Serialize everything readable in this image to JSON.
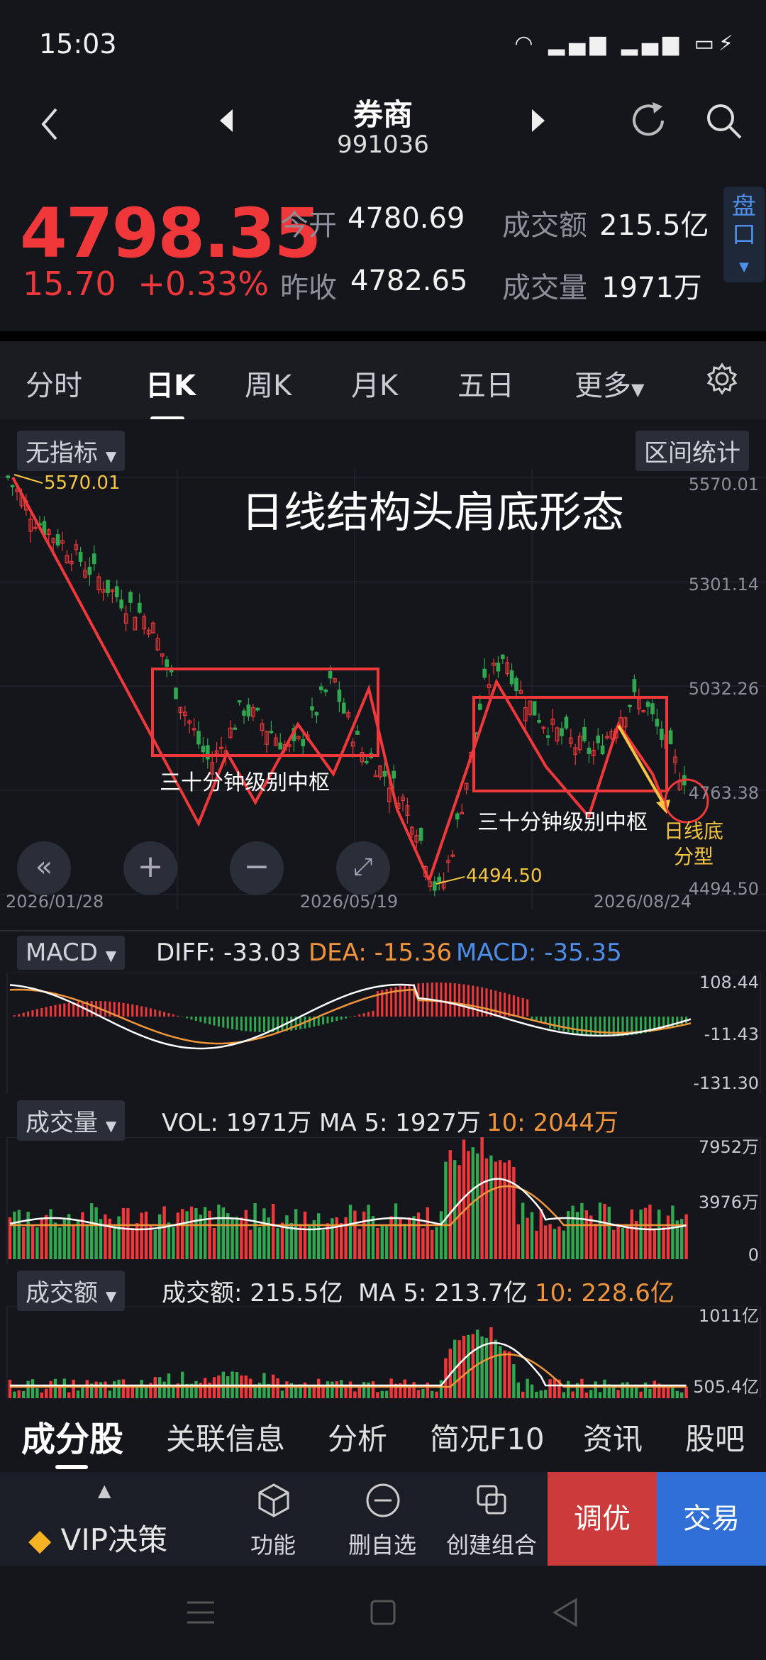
{
  "status": {
    "time": "15:03",
    "icons": "4G 4G"
  },
  "header": {
    "title": "券商",
    "code": "991036"
  },
  "quote": {
    "price": "4798.35",
    "change": "15.70",
    "change_pct": "+0.33%",
    "open_label": "今开",
    "open": "4780.69",
    "prev_label": "昨收",
    "prev": "4782.65",
    "amount_label": "成交额",
    "amount": "215.5亿",
    "volume_label": "成交量",
    "volume": "1971万",
    "pankou": "盘口"
  },
  "tabs": [
    "分时",
    "日K",
    "周K",
    "月K",
    "五日",
    "更多"
  ],
  "chart_toolbar": {
    "indicator": "无指标",
    "range_stats": "区间统计"
  },
  "chart_data": {
    "type": "candlestick",
    "y_ticks": [
      "5570.01",
      "5301.14",
      "5032.26",
      "4763.38",
      "4494.50"
    ],
    "x_ticks": [
      "2026/01/28",
      "2026/05/19",
      "2026/08/24"
    ],
    "high_label": "5570.01",
    "low_label": "4494.50",
    "annotation_title": "日线结构头肩底形态",
    "pivot_label": "三十分钟级别中枢",
    "bottom_label_1": "日线底",
    "bottom_label_2": "分型"
  },
  "macd": {
    "name": "MACD",
    "diff": "DIFF: -33.03",
    "dea": "DEA: -15.36",
    "macd": "MACD: -35.35",
    "ticks": [
      "108.44",
      "-11.43",
      "-131.30"
    ]
  },
  "vol": {
    "name": "成交量",
    "vol": "VOL: 1971万",
    "ma5": "MA 5: 1927万",
    "ma10": "10: 2044万",
    "ticks": [
      "7952万",
      "3976万",
      "0"
    ]
  },
  "amt": {
    "name": "成交额",
    "amt": "成交额: 215.5亿",
    "ma5": "MA 5: 213.7亿",
    "ma10": "10: 228.6亿",
    "ticks": [
      "1011亿",
      "505.4亿"
    ]
  },
  "bottom_tabs": [
    "成分股",
    "关联信息",
    "分析",
    "简况F10",
    "资讯",
    "股吧"
  ],
  "toolbar": {
    "vip": "VIP决策",
    "func": "功能",
    "remove": "删自选",
    "combo": "创建组合",
    "tune": "调优",
    "trade": "交易"
  },
  "colors": {
    "up": "#f0383b",
    "down": "#2fa84f",
    "accent": "#4d8ee8",
    "yellow": "#f5c542"
  }
}
